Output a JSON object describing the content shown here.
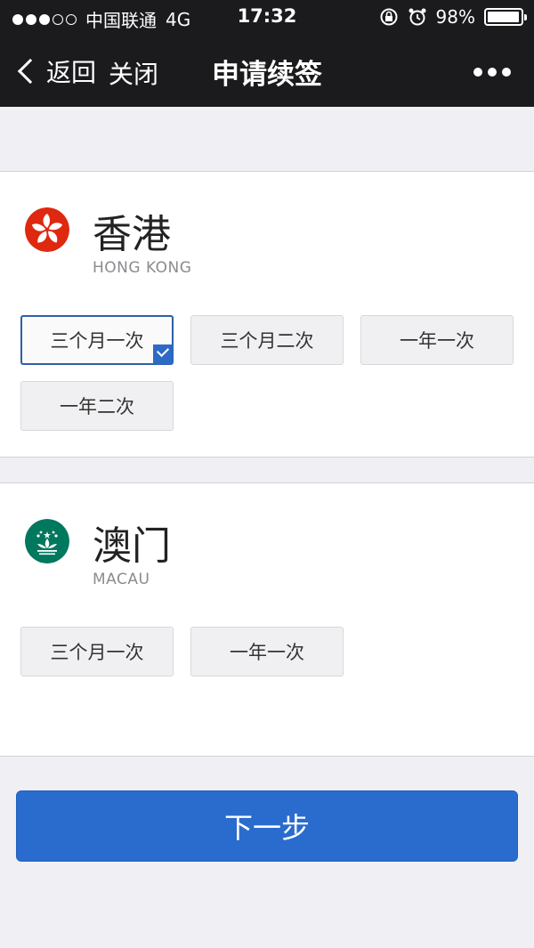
{
  "status": {
    "carrier": "中国联通",
    "network": "4G",
    "time": "17:32",
    "battery": "98%"
  },
  "nav": {
    "back_label": "返回",
    "close_label": "关闭",
    "title": "申请续签"
  },
  "regions": [
    {
      "name": "香港",
      "name_en": "HONG KONG",
      "emblem": "hong-kong-emblem",
      "options": [
        "三个月一次",
        "三个月二次",
        "一年一次",
        "一年二次"
      ],
      "selected": "三个月一次"
    },
    {
      "name": "澳门",
      "name_en": "MACAU",
      "emblem": "macau-emblem",
      "options": [
        "三个月一次",
        "一年一次"
      ],
      "selected": ""
    }
  ],
  "next_button": "下一步",
  "colors": {
    "accent": "#2a6cce",
    "topbar": "#1b1b1d",
    "hk_red": "#de2910",
    "macau_green": "#00785e"
  }
}
